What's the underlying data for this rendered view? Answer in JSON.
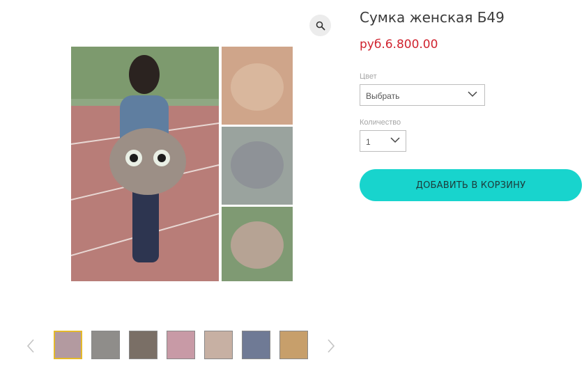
{
  "product": {
    "title": "Сумка женская Б49",
    "price": "руб.6.800.00"
  },
  "options": {
    "color_label": "Цвет",
    "color_value": "Выбрать",
    "quantity_label": "Количество",
    "quantity_value": "1"
  },
  "actions": {
    "add_to_cart": "ДОБАВИТЬ В КОРЗИНУ"
  },
  "gallery": {
    "thumbnail_count": 7,
    "active_thumbnail": 1
  },
  "colors": {
    "price": "#d0232f",
    "button": "#18d4cd",
    "active_thumb_border": "#e4b92b"
  },
  "icons": {
    "zoom": "magnifier-icon",
    "prev": "chevron-left-icon",
    "next": "chevron-right-icon",
    "select": "chevron-down-icon"
  }
}
